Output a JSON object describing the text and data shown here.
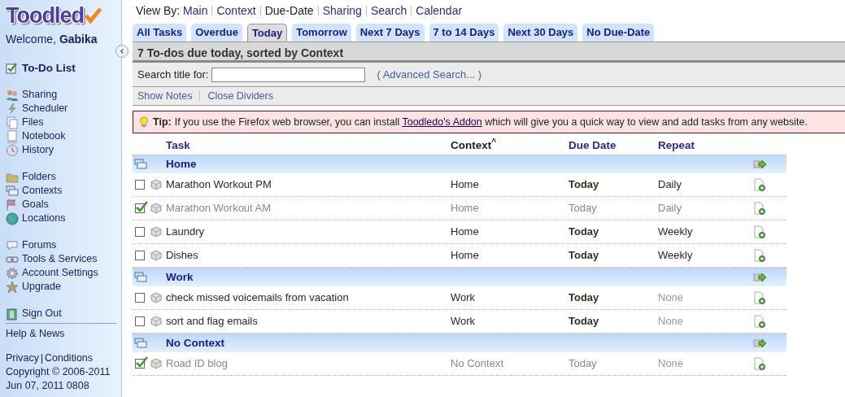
{
  "logo": {
    "text": "Toodled"
  },
  "sidebar": {
    "welcome": "Welcome,",
    "user": "Gabika",
    "groups": [
      [
        {
          "label": "To-Do List",
          "kind": "check",
          "selected": true
        }
      ],
      [
        {
          "label": "Sharing",
          "kind": "people",
          "selected": false
        },
        {
          "label": "Scheduler",
          "kind": "bolt",
          "selected": false
        },
        {
          "label": "Files",
          "kind": "files",
          "selected": false
        },
        {
          "label": "Notebook",
          "kind": "note",
          "selected": false
        },
        {
          "label": "History",
          "kind": "clock",
          "selected": false
        }
      ],
      [
        {
          "label": "Folders",
          "kind": "folder",
          "selected": false
        },
        {
          "label": "Contexts",
          "kind": "contexts",
          "selected": false
        },
        {
          "label": "Goals",
          "kind": "flag",
          "selected": false
        },
        {
          "label": "Locations",
          "kind": "globe",
          "selected": false
        }
      ],
      [
        {
          "label": "Forums",
          "kind": "bubble",
          "selected": false
        },
        {
          "label": "Tools & Services",
          "kind": "link",
          "selected": false
        },
        {
          "label": "Account Settings",
          "kind": "gear",
          "selected": false
        },
        {
          "label": "Upgrade",
          "kind": "star",
          "selected": false
        }
      ],
      [
        {
          "label": "Sign Out",
          "kind": "door",
          "selected": false
        }
      ]
    ],
    "help": "Help & News",
    "privacy": "Privacy",
    "conditions": "Conditions",
    "copyright": "Copyright © 2006-2011",
    "date": "Jun 07, 2011 0808"
  },
  "view_by": {
    "label": "View By:",
    "links": [
      {
        "label": "Main",
        "selected": false
      },
      {
        "label": "Context",
        "selected": false
      },
      {
        "label": "Due-Date",
        "selected": true
      },
      {
        "label": "Sharing",
        "selected": false
      },
      {
        "label": "Search",
        "selected": false
      },
      {
        "label": "Calendar",
        "selected": false
      }
    ]
  },
  "tabs": [
    {
      "label": "All Tasks",
      "selected": false
    },
    {
      "label": "Overdue",
      "selected": false
    },
    {
      "label": "Today",
      "selected": true
    },
    {
      "label": "Tomorrow",
      "selected": false
    },
    {
      "label": "Next 7 Days",
      "selected": false
    },
    {
      "label": "7 to 14 Days",
      "selected": false
    },
    {
      "label": "Next 30 Days",
      "selected": false
    },
    {
      "label": "No Due-Date",
      "selected": false
    }
  ],
  "header": "7 To-dos due today, sorted by Context",
  "search": {
    "label": "Search title for:",
    "advanced": "( Advanced Search... )"
  },
  "actions": [
    "Show Notes",
    "Close Dividers"
  ],
  "tip": {
    "label": "Tip:",
    "before": "If you use the Firefox web browser, you can install",
    "link": "Toodledo's Addon",
    "after": "which will give you a quick way to view and add tasks from any website."
  },
  "table": {
    "columns": [
      {
        "label": "Task",
        "sorted": false
      },
      {
        "label": "Context",
        "sorted": true,
        "sort_mark": "^"
      },
      {
        "label": "Due Date",
        "sorted": false
      },
      {
        "label": "Repeat",
        "sorted": false
      }
    ],
    "groups": [
      {
        "name": "Home",
        "tasks": [
          {
            "title": "Marathon Workout PM",
            "checked": false,
            "context": "Home",
            "due": "Today",
            "repeat": "Daily",
            "repeat_set": true
          },
          {
            "title": "Marathon Workout AM",
            "checked": true,
            "context": "Home",
            "due": "Today",
            "repeat": "Daily",
            "repeat_set": true
          },
          {
            "title": "Laundry",
            "checked": false,
            "context": "Home",
            "due": "Today",
            "repeat": "Weekly",
            "repeat_set": true
          },
          {
            "title": "Dishes",
            "checked": false,
            "context": "Home",
            "due": "Today",
            "repeat": "Weekly",
            "repeat_set": true
          }
        ]
      },
      {
        "name": "Work",
        "tasks": [
          {
            "title": "check missed voicemails from vacation",
            "checked": false,
            "context": "Work",
            "due": "Today",
            "repeat": "None",
            "repeat_set": false
          },
          {
            "title": "sort and flag emails",
            "checked": false,
            "context": "Work",
            "due": "Today",
            "repeat": "None",
            "repeat_set": false
          }
        ]
      },
      {
        "name": "No Context",
        "tasks": [
          {
            "title": "Road ID blog",
            "checked": true,
            "context": "No Context",
            "due": "Today",
            "repeat": "None",
            "repeat_set": false
          }
        ]
      }
    ]
  }
}
